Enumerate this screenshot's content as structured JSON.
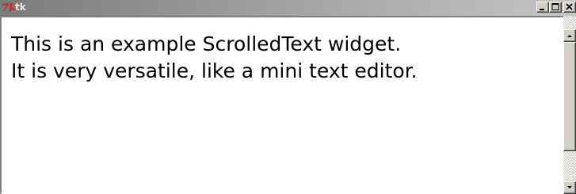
{
  "window": {
    "title": "tk",
    "logo_text": "7k",
    "controls": [
      "minimize",
      "maximize",
      "close"
    ],
    "colors": {
      "logo": "#d42020",
      "title_text": "#e8e8e8",
      "frame": "#d4d0c8"
    }
  },
  "text_widget": {
    "lines": [
      "This is an example ScrolledText widget.",
      "It is very versatile, like a mini text editor."
    ],
    "background": "#ffffff"
  },
  "scrollbar": {
    "icons": [
      "arrow-up-icon",
      "arrow-down-icon"
    ]
  }
}
